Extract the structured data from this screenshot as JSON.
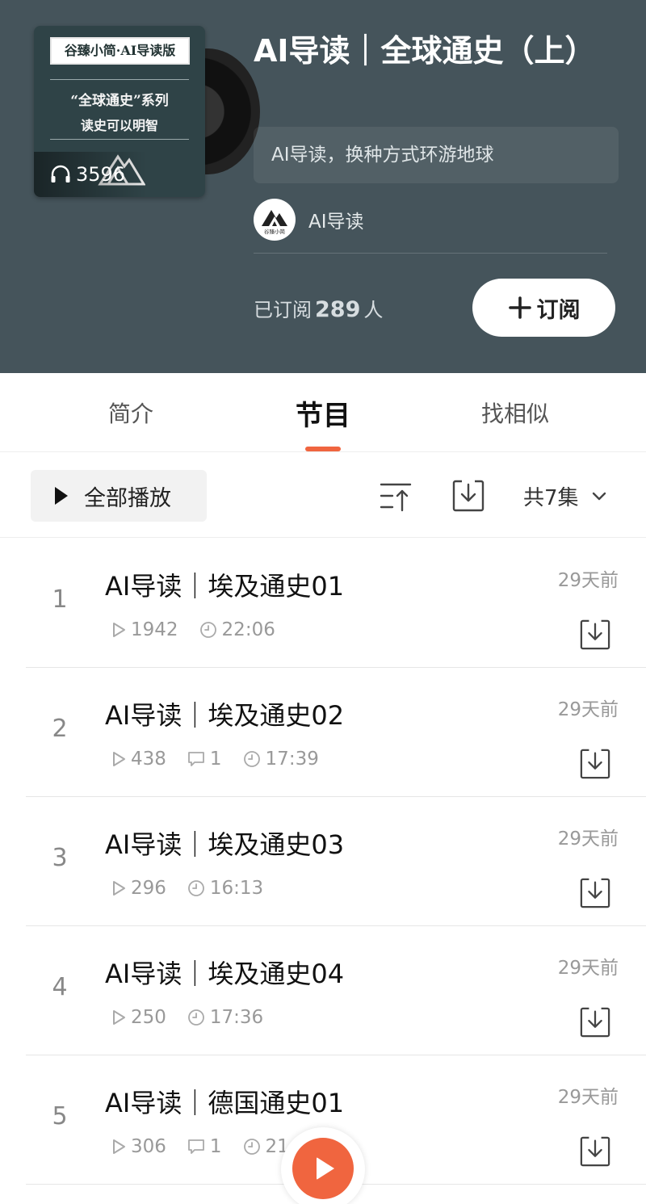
{
  "album": {
    "cover_badge": "谷臻小简·AI导读版",
    "cover_series": "“全球通史”系列",
    "cover_subtitle": "读史可以明智",
    "cover_plays": "3596",
    "title": "AI导读｜全球通史（上）",
    "description": "AI导读，换种方式环游地球",
    "author": "AI导读",
    "author_logo_text": "谷臻小简",
    "subscribed_prefix": "已订阅",
    "subscribed_count": "289",
    "subscribed_suffix": "人",
    "subscribe_label": "订阅"
  },
  "tabs": [
    {
      "label": "简介"
    },
    {
      "label": "节目"
    },
    {
      "label": "找相似"
    }
  ],
  "toolbar": {
    "play_all_label": "全部播放",
    "episode_count": "共7集"
  },
  "episodes": [
    {
      "index": "1",
      "title": "AI导读｜埃及通史01",
      "plays": "1942",
      "comments": "",
      "duration": "22:06",
      "date": "29天前"
    },
    {
      "index": "2",
      "title": "AI导读｜埃及通史02",
      "plays": "438",
      "comments": "1",
      "duration": "17:39",
      "date": "29天前"
    },
    {
      "index": "3",
      "title": "AI导读｜埃及通史03",
      "plays": "296",
      "comments": "",
      "duration": "16:13",
      "date": "29天前"
    },
    {
      "index": "4",
      "title": "AI导读｜埃及通史04",
      "plays": "250",
      "comments": "",
      "duration": "17:36",
      "date": "29天前"
    },
    {
      "index": "5",
      "title": "AI导读｜德国通史01",
      "plays": "306",
      "comments": "1",
      "duration": "21",
      "date": "29天前"
    }
  ],
  "colors": {
    "header_bg": "#45545b",
    "accent": "#f0653f"
  },
  "icons": {
    "cover_plays": "headphones-icon",
    "play_all": "play-icon",
    "sort": "sort-icon",
    "batch_download": "download-icon",
    "expand": "chevron-down-icon",
    "plays": "play-outline-icon",
    "comments": "comment-icon",
    "duration": "clock-icon",
    "episode_download": "download-icon",
    "player": "play-icon"
  }
}
